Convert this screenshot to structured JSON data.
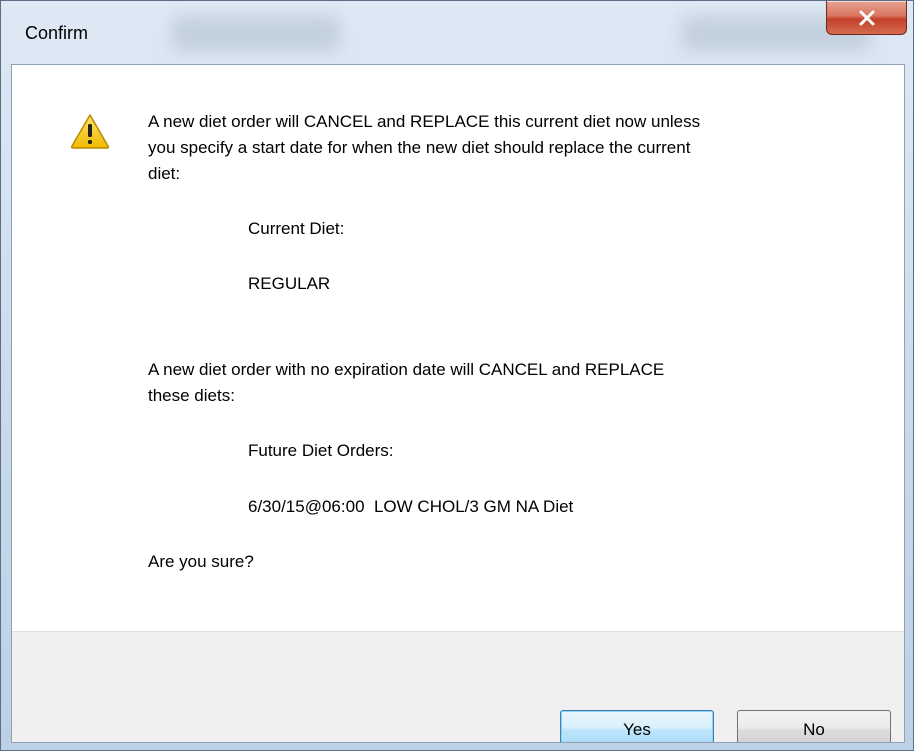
{
  "window": {
    "title": "Confirm"
  },
  "icons": {
    "close": "close-icon",
    "warning": "warning-icon"
  },
  "message": {
    "line1": "A new diet order will CANCEL and REPLACE this current diet now unless",
    "line2": "you specify a start date for when the new diet should replace the current",
    "line3": "diet:",
    "current_diet_label": "Current Diet:",
    "current_diet_value": "REGULAR",
    "line4": "A new diet order with no expiration date will CANCEL and REPLACE",
    "line5": "these diets:",
    "future_label": "Future Diet Orders:",
    "future_value": "6/30/15@06:00  LOW CHOL/3 GM NA Diet",
    "question": "Are you sure?"
  },
  "buttons": {
    "yes": "Yes",
    "no": "No"
  },
  "colors": {
    "close_button": "#c2412b",
    "default_button_border": "#3c7fb1",
    "warning_yellow": "#f5c400"
  }
}
